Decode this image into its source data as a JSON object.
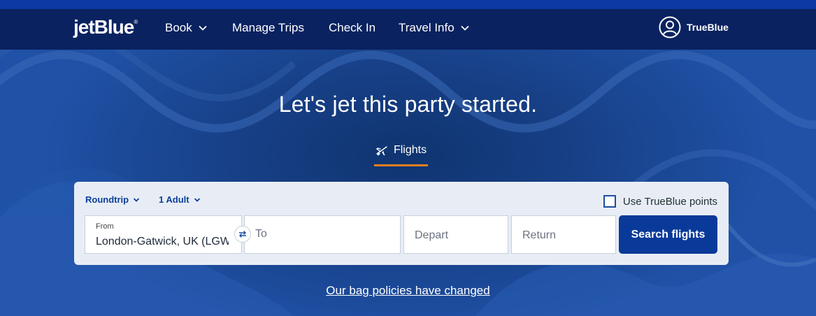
{
  "nav": {
    "logo": "jetBlue",
    "logo_mark": "®",
    "items": [
      {
        "label": "Book",
        "dropdown": true
      },
      {
        "label": "Manage Trips",
        "dropdown": false
      },
      {
        "label": "Check In",
        "dropdown": false
      },
      {
        "label": "Travel Info",
        "dropdown": true
      }
    ],
    "trueblue_label": "TrueBlue",
    "trueblue_icon": "user-circle-icon"
  },
  "hero": {
    "headline": "Let's jet this party started.",
    "tab_label": "Flights",
    "tab_icon": "plane-icon",
    "accent_color": "#f07f1d"
  },
  "booking": {
    "trip_type": "Roundtrip",
    "passengers": "1 Adult",
    "points_label": "Use TrueBlue points",
    "points_checked": false,
    "from_label": "From",
    "from_value": "London-Gatwick, UK (LGW)",
    "to_placeholder": "To",
    "depart_placeholder": "Depart",
    "return_placeholder": "Return",
    "search_label": "Search flights",
    "swap_icon": "swap-arrows-icon"
  },
  "footer_link": "Our bag policies have changed",
  "colors": {
    "nav_bg": "#0a2260",
    "button_bg": "#0a3a99",
    "link_blue": "#0b3f9a"
  }
}
